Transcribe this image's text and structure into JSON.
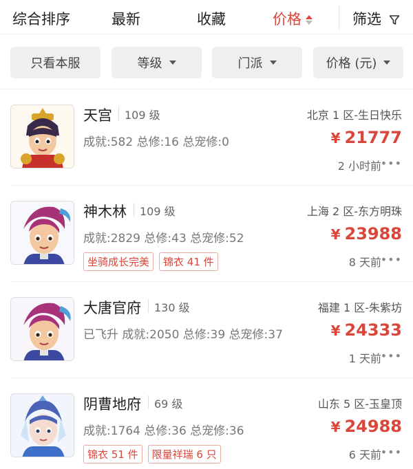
{
  "sortbar": {
    "items": [
      {
        "label": "综合排序"
      },
      {
        "label": "最新"
      },
      {
        "label": "收藏"
      },
      {
        "label": "价格"
      }
    ],
    "filter_label": "筛选",
    "active_color": "#d9463c"
  },
  "filters": [
    {
      "label": "只看本服"
    },
    {
      "label": "等级"
    },
    {
      "label": "门派"
    },
    {
      "label": "价格 (元)"
    }
  ],
  "listings": [
    {
      "name": "天宫",
      "level": "109 级",
      "server": "北京 1 区-生日快乐",
      "stats": "成就:582 总修:16 总宠修:0",
      "price": "21777",
      "currency": "¥",
      "tags": [],
      "time": "2 小时前",
      "avatar_icon": "character-avatar-icon"
    },
    {
      "name": "神木林",
      "level": "109 级",
      "server": "上海 2 区-东方明珠",
      "stats": "成就:2829 总修:43 总宠修:52",
      "price": "23988",
      "currency": "¥",
      "tags": [
        "坐骑成长完美",
        "锦衣 41 件"
      ],
      "time": "8 天前",
      "avatar_icon": "character-avatar-icon"
    },
    {
      "name": "大唐官府",
      "level": "130 级",
      "server": "福建 1 区-朱紫坊",
      "stats": "已飞升 成就:2050 总修:39 总宠修:37",
      "price": "24333",
      "currency": "¥",
      "tags": [],
      "time": "1 天前",
      "avatar_icon": "character-avatar-icon"
    },
    {
      "name": "阴曹地府",
      "level": "69 级",
      "server": "山东 5 区-玉皇顶",
      "stats": "成就:1764 总修:36 总宠修:36",
      "price": "24988",
      "currency": "¥",
      "tags": [
        "锦衣 51 件",
        "限量祥瑞 6 只"
      ],
      "time": "6 天前",
      "avatar_icon": "character-avatar-icon"
    }
  ]
}
